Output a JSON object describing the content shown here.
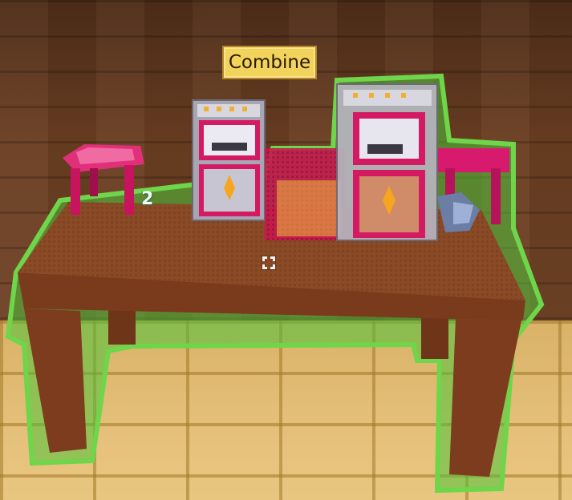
{
  "tooltip": {
    "label": "Combine"
  },
  "stack_count": "2",
  "icons": {
    "crosshair": "crosshair-icon",
    "selection_outline": "selection-outline"
  },
  "colors": {
    "selection_outline": "#6fd54a",
    "tooltip_bg": "#f2d35b",
    "table_wood": "#8a4a25",
    "stool_pink": "#d81a6e",
    "oven_gray": "#a9a6b3"
  }
}
